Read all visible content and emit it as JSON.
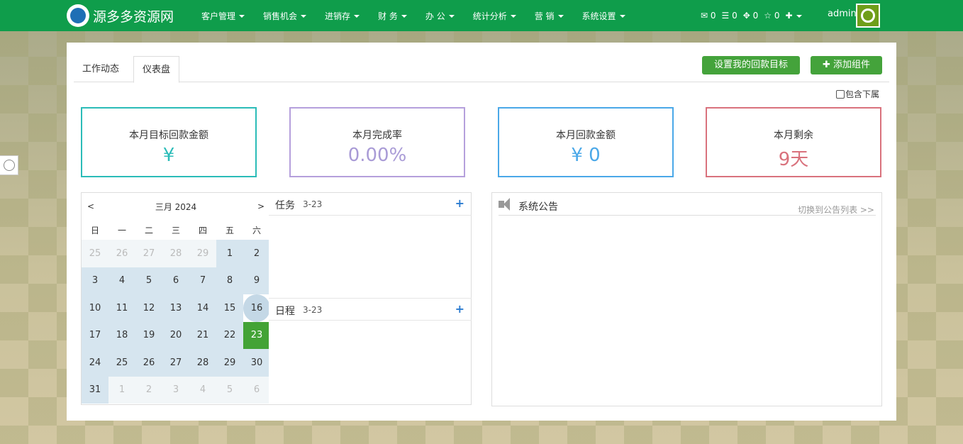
{
  "brand": {
    "name": "源多多资源网"
  },
  "nav": [
    "客户管理",
    "销售机会",
    "进销存",
    "财 务",
    "办 公",
    "统计分析",
    "营 销",
    "系统设置"
  ],
  "header_counts": {
    "mail": "0",
    "list": "0",
    "tasks": "0",
    "star": "0"
  },
  "user": {
    "name": "admin"
  },
  "tabs": [
    "工作动态",
    "仪表盘"
  ],
  "buttons": {
    "set_target": "设置我的回款目标",
    "add_widget": "添加组件"
  },
  "include_sub": "包含下属",
  "stats": [
    {
      "label": "本月目标回款金额",
      "value": "¥"
    },
    {
      "label": "本月完成率",
      "value": "0.00%"
    },
    {
      "label": "本月回款金额",
      "value": "¥ 0"
    },
    {
      "label": "本月剩余",
      "value": "9天"
    }
  ],
  "calendar": {
    "title": "三月 2024",
    "prev": "<",
    "next": ">",
    "weekdays": [
      "日",
      "一",
      "二",
      "三",
      "四",
      "五",
      "六"
    ],
    "days": [
      "25",
      "26",
      "27",
      "28",
      "29",
      "1",
      "2",
      "3",
      "4",
      "5",
      "6",
      "7",
      "8",
      "9",
      "10",
      "11",
      "12",
      "13",
      "14",
      "15",
      "16",
      "17",
      "18",
      "19",
      "20",
      "21",
      "22",
      "23",
      "24",
      "25",
      "26",
      "27",
      "28",
      "29",
      "30",
      "31",
      "1",
      "2",
      "3",
      "4",
      "5",
      "6"
    ],
    "today": "23"
  },
  "tasks": {
    "title": "任务",
    "date": "3-23",
    "plus": "+"
  },
  "schedule": {
    "title": "日程",
    "date": "3-23",
    "plus": "+"
  },
  "notice": {
    "title": "系统公告",
    "switch": "切换到公告列表 >>"
  }
}
